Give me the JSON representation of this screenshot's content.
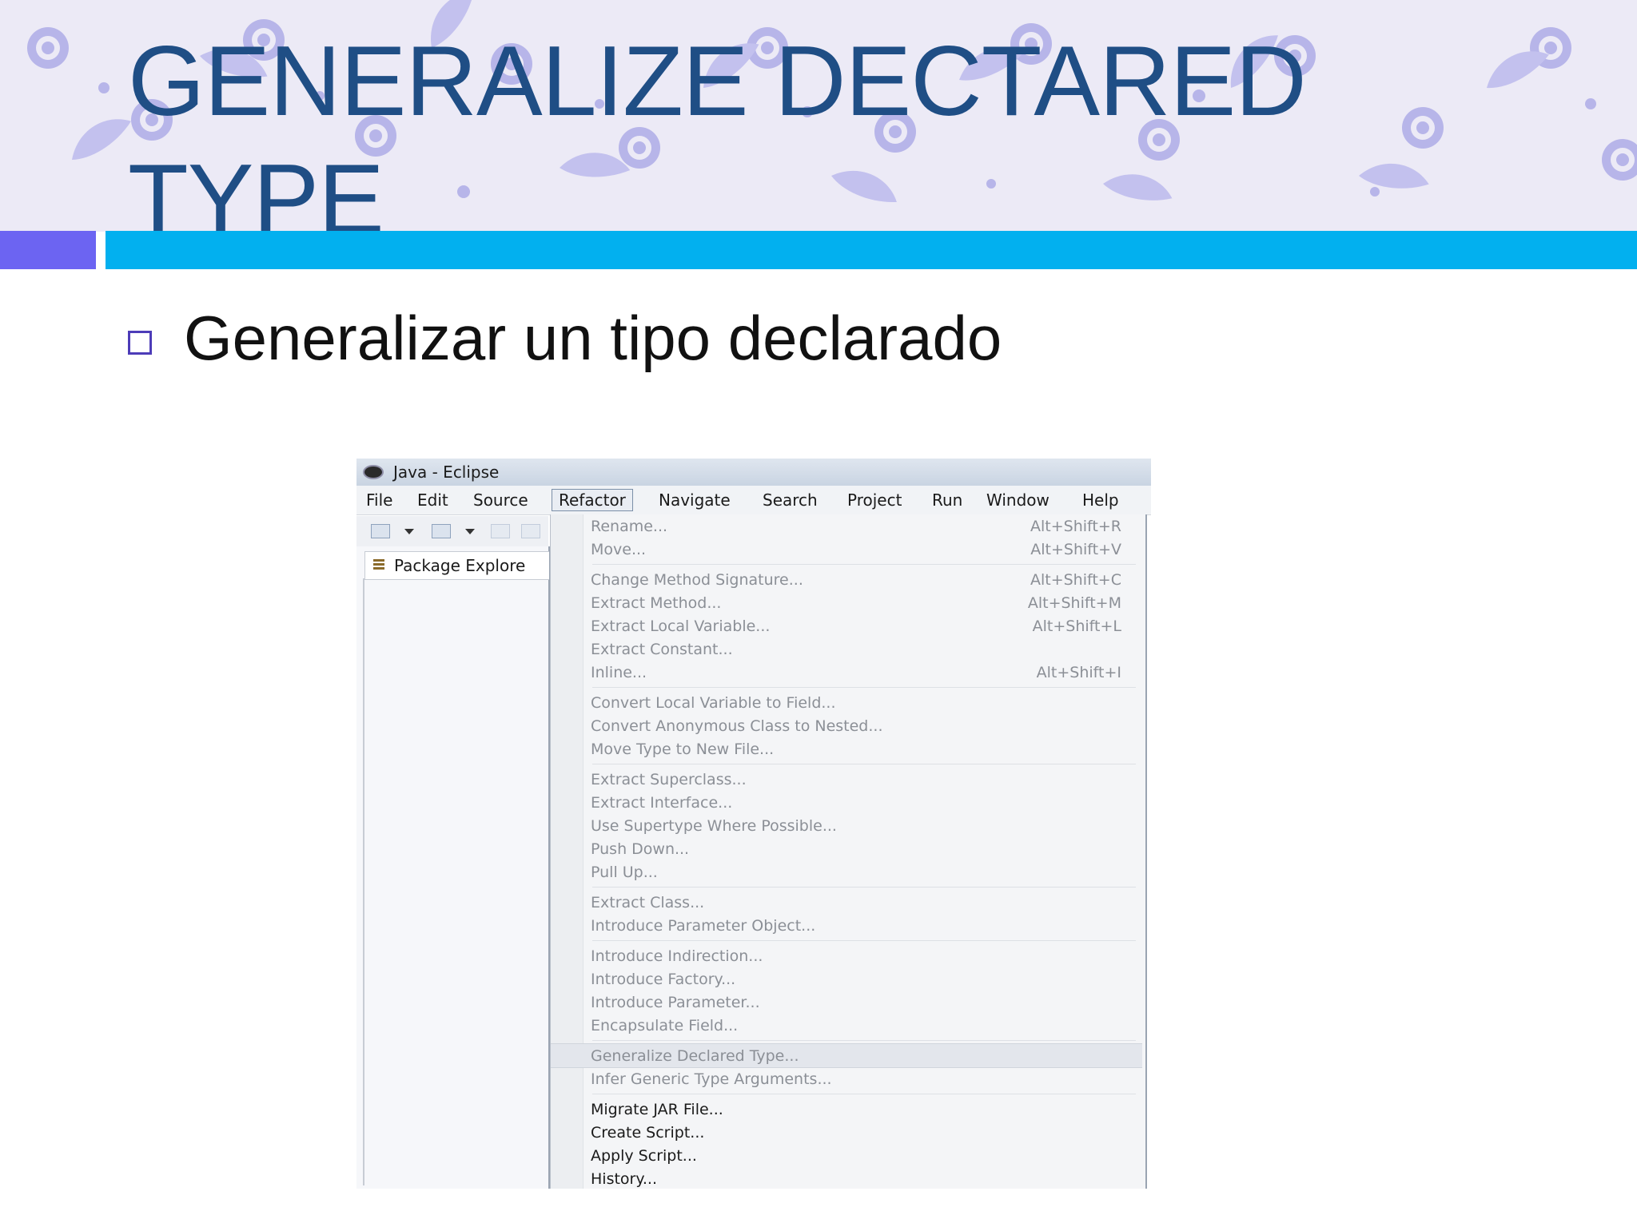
{
  "slide": {
    "title": "GENERALIZE DECTARED TYPE",
    "bullet": "Generalizar un tipo declarado"
  },
  "colors": {
    "title": "#1f4e85",
    "accent_square": "#6c64f2",
    "accent_bar": "#02b0ef",
    "banner_pattern": "#b7b5e9"
  },
  "eclipse": {
    "window_title": "Java - Eclipse",
    "menus": [
      "File",
      "Edit",
      "Source",
      "Refactor",
      "Navigate",
      "Search",
      "Project",
      "Run",
      "Window",
      "Help"
    ],
    "active_menu": "Refactor",
    "package_explorer_label": "Package Explore",
    "refactor_items": [
      {
        "label": "Rename...",
        "shortcut": "Alt+Shift+R",
        "enabled": false
      },
      {
        "label": "Move...",
        "shortcut": "Alt+Shift+V",
        "enabled": false
      },
      {
        "label": "Change Method Signature...",
        "shortcut": "Alt+Shift+C",
        "enabled": false
      },
      {
        "label": "Extract Method...",
        "shortcut": "Alt+Shift+M",
        "enabled": false
      },
      {
        "label": "Extract Local Variable...",
        "shortcut": "Alt+Shift+L",
        "enabled": false
      },
      {
        "label": "Extract Constant...",
        "shortcut": "",
        "enabled": false
      },
      {
        "label": "Inline...",
        "shortcut": "Alt+Shift+I",
        "enabled": false
      },
      {
        "label": "Convert Local Variable to Field...",
        "shortcut": "",
        "enabled": false
      },
      {
        "label": "Convert Anonymous Class to Nested...",
        "shortcut": "",
        "enabled": false
      },
      {
        "label": "Move Type to New File...",
        "shortcut": "",
        "enabled": false
      },
      {
        "label": "Extract Superclass...",
        "shortcut": "",
        "enabled": false
      },
      {
        "label": "Extract Interface...",
        "shortcut": "",
        "enabled": false
      },
      {
        "label": "Use Supertype Where Possible...",
        "shortcut": "",
        "enabled": false
      },
      {
        "label": "Push Down...",
        "shortcut": "",
        "enabled": false
      },
      {
        "label": "Pull Up...",
        "shortcut": "",
        "enabled": false
      },
      {
        "label": "Extract Class...",
        "shortcut": "",
        "enabled": false
      },
      {
        "label": "Introduce Parameter Object...",
        "shortcut": "",
        "enabled": false
      },
      {
        "label": "Introduce Indirection...",
        "shortcut": "",
        "enabled": false
      },
      {
        "label": "Introduce Factory...",
        "shortcut": "",
        "enabled": false
      },
      {
        "label": "Introduce Parameter...",
        "shortcut": "",
        "enabled": false
      },
      {
        "label": "Encapsulate Field...",
        "shortcut": "",
        "enabled": false
      },
      {
        "label": "Generalize Declared Type...",
        "shortcut": "",
        "enabled": false,
        "highlighted": true
      },
      {
        "label": "Infer Generic Type Arguments...",
        "shortcut": "",
        "enabled": false
      },
      {
        "label": "Migrate JAR File...",
        "shortcut": "",
        "enabled": true
      },
      {
        "label": "Create Script...",
        "shortcut": "",
        "enabled": true
      },
      {
        "label": "Apply Script...",
        "shortcut": "",
        "enabled": true
      },
      {
        "label": "History...",
        "shortcut": "",
        "enabled": true
      }
    ]
  }
}
